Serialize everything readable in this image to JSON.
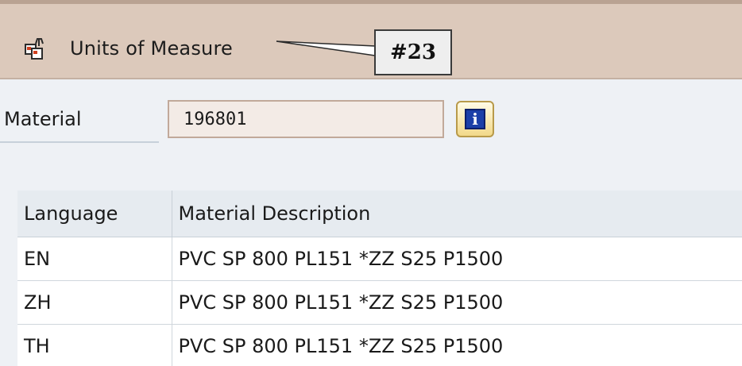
{
  "toolbar": {
    "uom_label": "Units of Measure",
    "callout_label": "#23"
  },
  "material": {
    "label": "Material",
    "value": "196801"
  },
  "table": {
    "headers": [
      "Language",
      "Material Description"
    ],
    "rows": [
      {
        "language": "EN",
        "description": "PVC SP 800 PL151 *ZZ S25 P1500"
      },
      {
        "language": "ZH",
        "description": "PVC SP 800 PL151 *ZZ S25 P1500"
      },
      {
        "language": "TH",
        "description": "PVC SP 800 PL151 *ZZ S25 P1500"
      }
    ]
  },
  "icons": {
    "uom_icon": "units-of-measure-icon",
    "info_icon": "info-icon"
  },
  "colors": {
    "toolbar_bg": "#dcc9bb",
    "input_bg": "#f3ebe6",
    "info_blue": "#1b3fa8"
  }
}
